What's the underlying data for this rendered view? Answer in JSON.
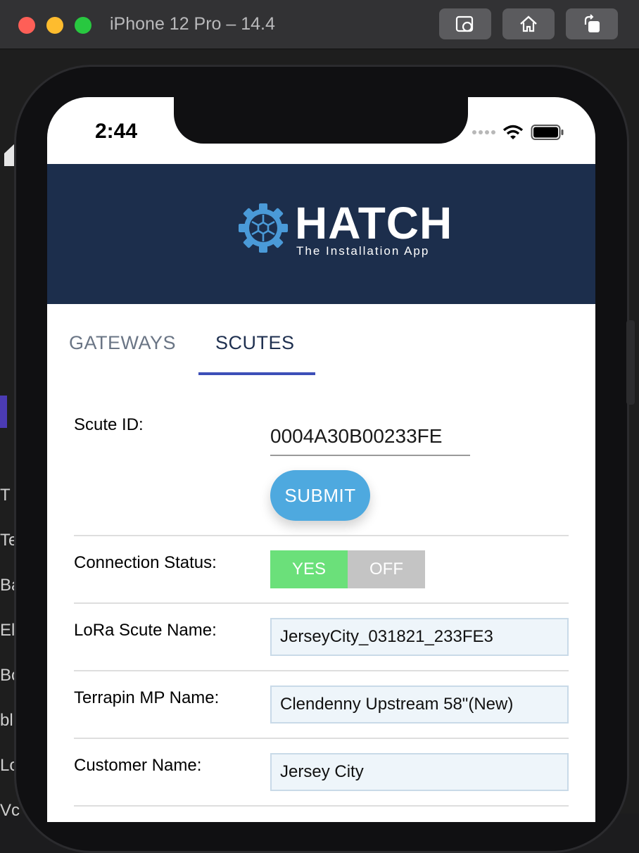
{
  "simulator": {
    "title": "iPhone 12 Pro – 14.4",
    "buttons": [
      "screenshot-icon",
      "home-icon",
      "rotate-icon"
    ]
  },
  "background_letters": [
    "T",
    "Te",
    "Ba",
    "El",
    "Bo",
    "bl",
    "Lo",
    "Vc"
  ],
  "status_bar": {
    "time": "2:44"
  },
  "header": {
    "logo_title": "HATCH",
    "logo_subtitle": "The Installation App",
    "background_color": "#1c2e4c"
  },
  "tabs": [
    {
      "label": "GATEWAYS",
      "active": false
    },
    {
      "label": "SCUTES",
      "active": true
    }
  ],
  "form": {
    "scute_id_label": "Scute ID:",
    "scute_id_value": "0004A30B00233FE",
    "submit_label": "SUBMIT",
    "connection_status_label": "Connection Status:",
    "toggle_yes": "YES",
    "toggle_off": "OFF",
    "lora_label": "LoRa Scute Name:",
    "lora_value": "JerseyCity_031821_233FE3",
    "terrapin_label": "Terrapin MP Name:",
    "terrapin_value": "Clendenny Upstream 58\"(New)",
    "customer_label": "Customer Name:",
    "customer_value": "Jersey City"
  },
  "colors": {
    "accent": "#4ea9df",
    "tab_indicator": "#3d4fb8",
    "toggle_on": "#6be07a",
    "toggle_off": "#c4c4c4"
  }
}
